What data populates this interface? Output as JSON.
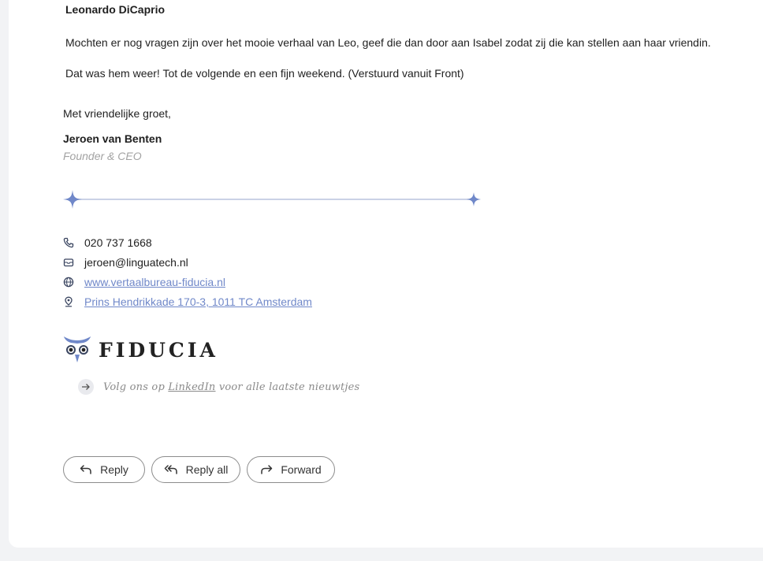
{
  "email": {
    "quoted_name": "Leonardo DiCaprio",
    "paragraph_1": "Mochten er nog vragen zijn over het mooie verhaal van Leo, geef die dan door aan Isabel zodat zij die kan stellen aan haar vriendin.",
    "paragraph_2": "Dat was hem weer! Tot de volgende en een fijn weekend. (Verstuurd vanuit Front)",
    "closing": "Met vriendelijke groet,"
  },
  "signature": {
    "name": "Jeroen van Benten",
    "role": "Founder & CEO",
    "phone": "020 737 1668",
    "email": "jeroen@linguatech.nl",
    "website": "www.vertaalbureau-fiducia.nl",
    "address": "Prins Hendrikkade 170-3, 1011 TC Amsterdam",
    "logo_text": "FIDUCIA",
    "cta_prefix": "Volg ons op ",
    "cta_link": "LinkedIn",
    "cta_suffix": " voor alle laatste nieuwtjes",
    "accent_color": "#7088c9"
  },
  "actions": {
    "reply": "Reply",
    "reply_all": "Reply all",
    "forward": "Forward"
  }
}
